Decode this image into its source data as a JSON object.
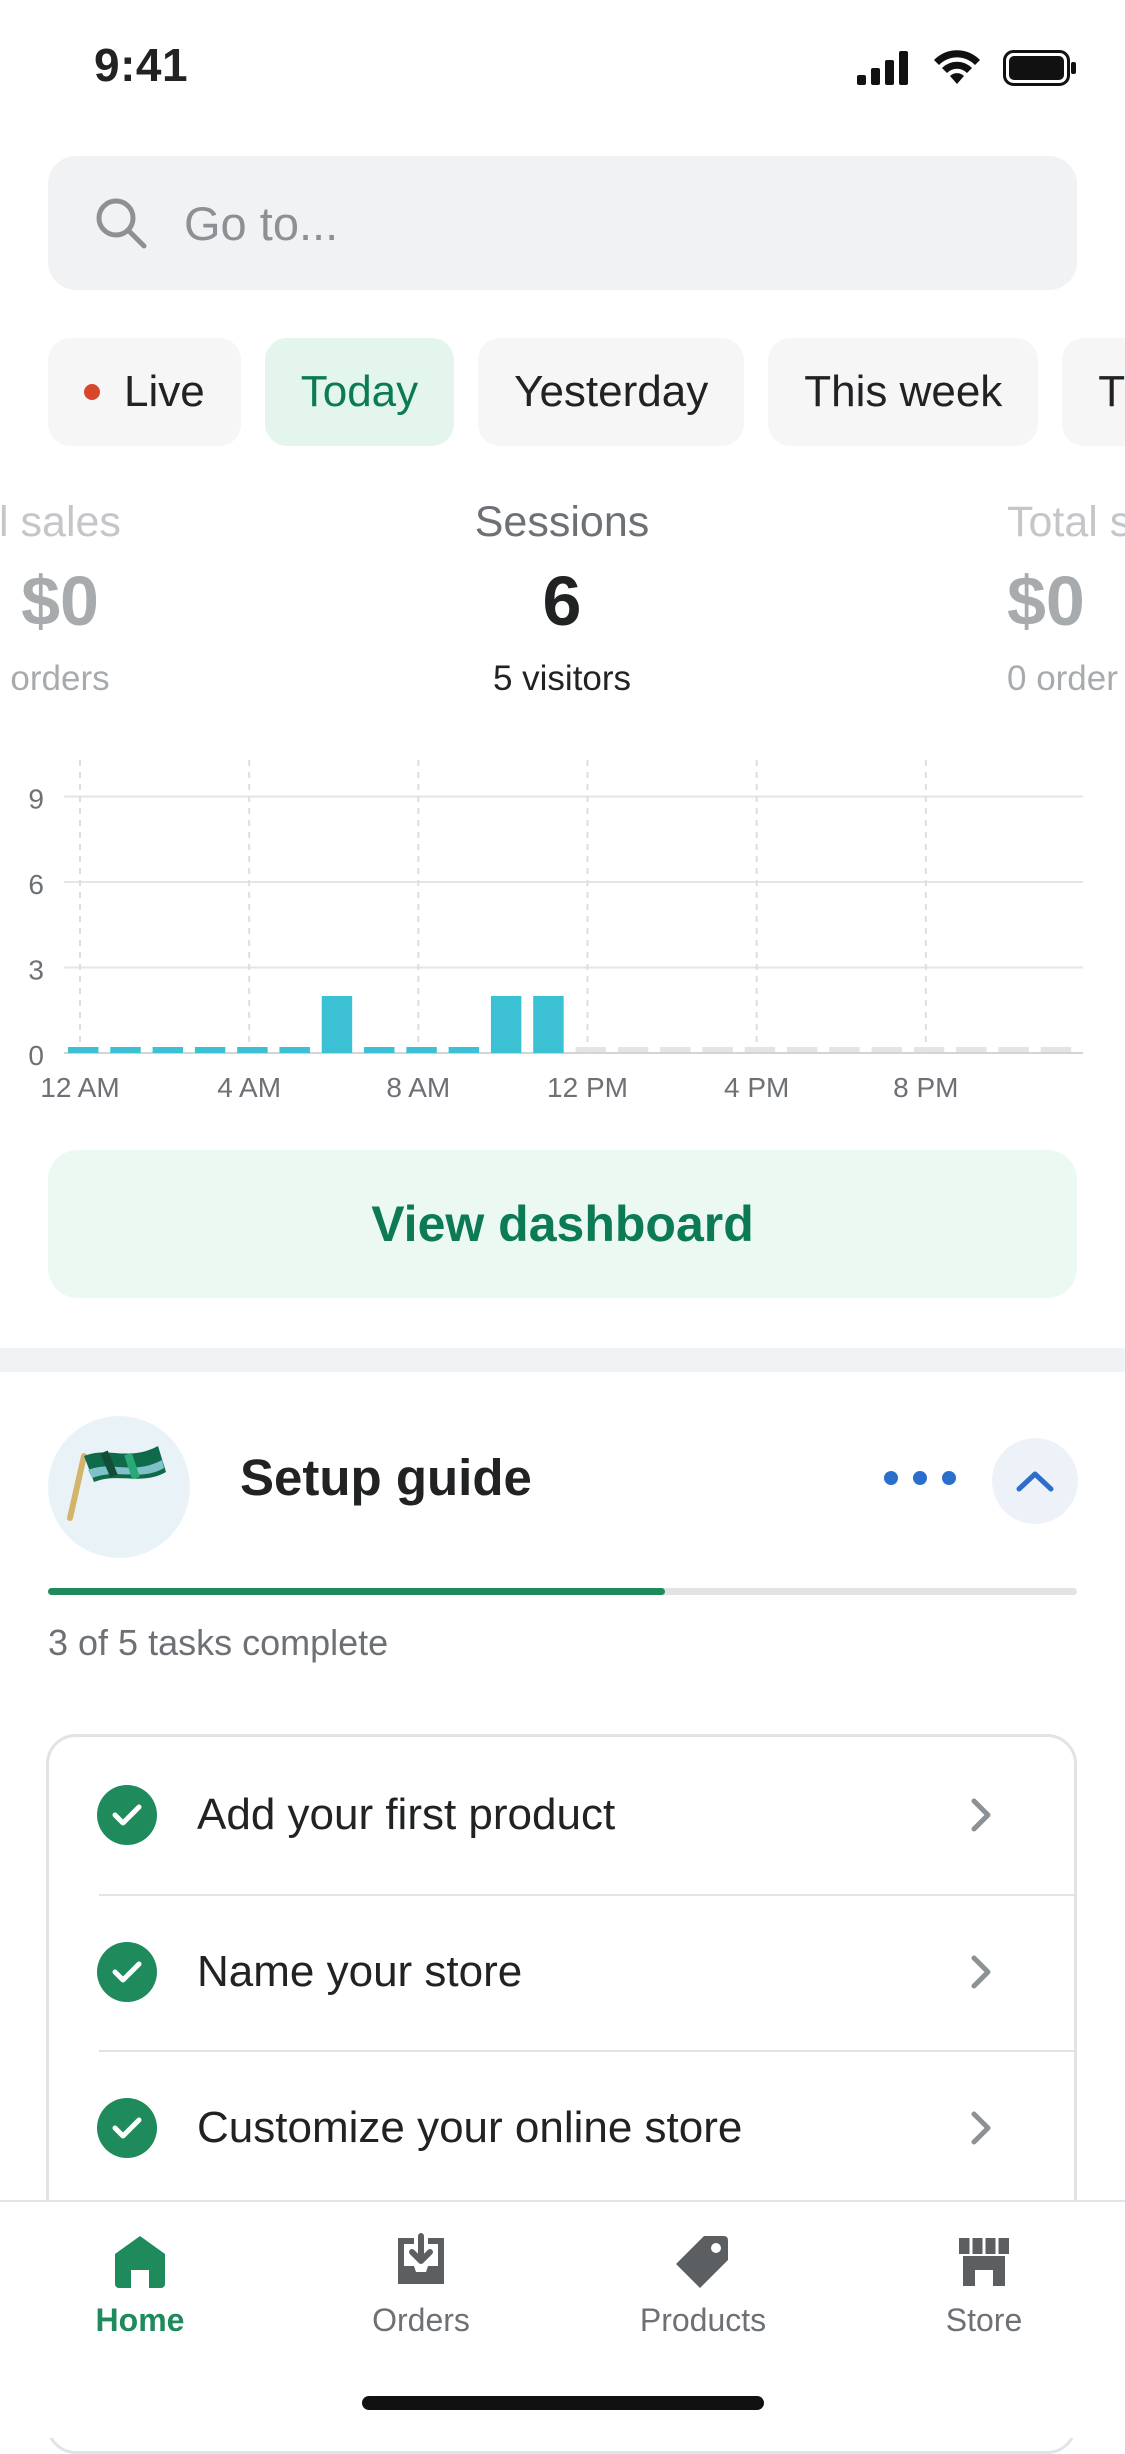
{
  "status_bar": {
    "time": "9:41"
  },
  "search": {
    "placeholder": "Go to..."
  },
  "filters": [
    {
      "label": "Live",
      "active": false
    },
    {
      "label": "Today",
      "active": true
    },
    {
      "label": "Yesterday",
      "active": false
    },
    {
      "label": "This week",
      "active": false
    },
    {
      "label": "T",
      "active": false
    }
  ],
  "metrics": {
    "left": {
      "label": "l sales",
      "value": "$0",
      "sub": "orders"
    },
    "center": {
      "label": "Sessions",
      "value": "6",
      "sub": "5 visitors"
    },
    "right": {
      "label": "Total s",
      "value": "$0",
      "sub": "0 order"
    }
  },
  "chart_data": {
    "type": "bar",
    "categories": [
      "12 AM",
      "1 AM",
      "2 AM",
      "3 AM",
      "4 AM",
      "5 AM",
      "6 AM",
      "7 AM",
      "8 AM",
      "9 AM",
      "10 AM",
      "11 AM",
      "12 PM",
      "1 PM",
      "2 PM",
      "3 PM",
      "4 PM",
      "5 PM",
      "6 PM",
      "7 PM",
      "8 PM",
      "9 PM",
      "10 PM",
      "11 PM"
    ],
    "values": [
      0,
      0,
      0,
      0,
      0,
      0,
      2,
      0,
      0,
      0,
      2,
      2,
      null,
      null,
      null,
      null,
      null,
      null,
      null,
      null,
      null,
      null,
      null,
      null
    ],
    "x_tick_labels": [
      "12 AM",
      "4 AM",
      "8 AM",
      "12 PM",
      "4 PM",
      "8 PM"
    ],
    "y_ticks": [
      0,
      3,
      6,
      9
    ],
    "ylim": [
      0,
      10
    ],
    "grid": true,
    "bar_color": "#3bc1d3",
    "future_color": "#e3e4e6"
  },
  "dashboard_button": {
    "label": "View dashboard"
  },
  "setup_guide": {
    "title": "Setup guide",
    "progress": {
      "completed": 3,
      "total": 5
    },
    "count_text": "3 of 5 tasks complete",
    "tasks": [
      {
        "label": "Add your first product",
        "done": true
      },
      {
        "label": "Name your store",
        "done": true
      },
      {
        "label": "Customize your online store",
        "done": true
      }
    ]
  },
  "tabbar": [
    {
      "label": "Home",
      "icon": "home-icon",
      "active": true
    },
    {
      "label": "Orders",
      "icon": "orders-icon",
      "active": false
    },
    {
      "label": "Products",
      "icon": "tag-icon",
      "active": false
    },
    {
      "label": "Store",
      "icon": "store-icon",
      "active": false
    }
  ],
  "colors": {
    "accent": "#1f8a5c",
    "link": "#2c6ecb",
    "chip_active_bg": "#e3f5ec"
  }
}
